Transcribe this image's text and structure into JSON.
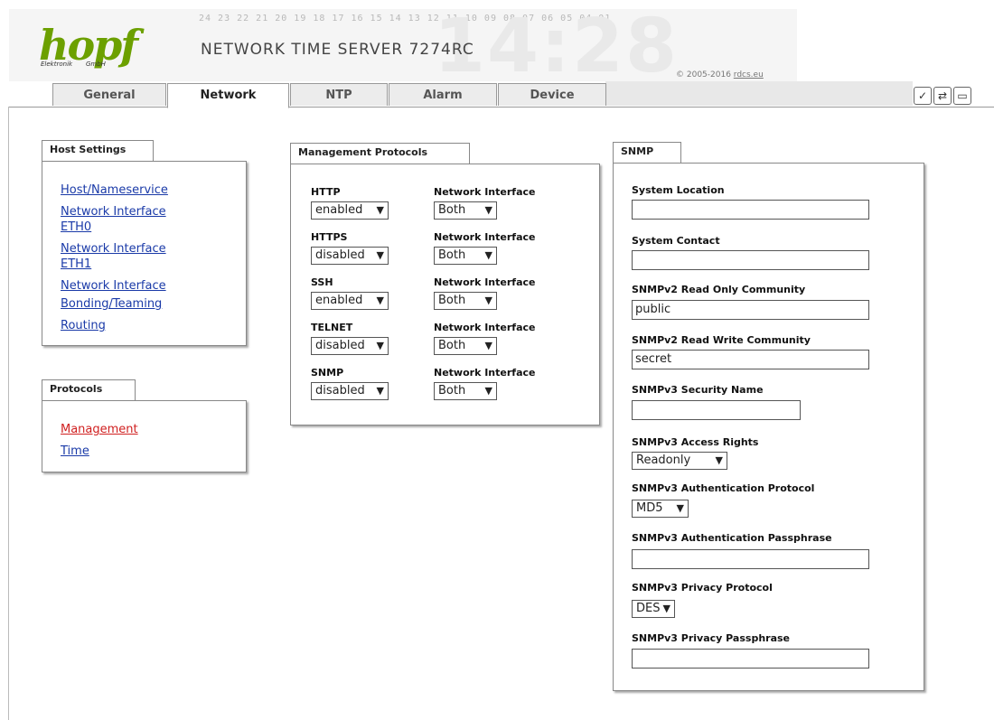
{
  "header": {
    "logo_text": "hopf",
    "logo_sub_left": "Elektronik",
    "logo_sub_right": "GmbH",
    "title": "NETWORK TIME SERVER 7274RC",
    "digits": "24 23 22 21 20 19 18 17 16 15 14 13 12 11 10 09 08 07 06 05 04 01",
    "copyright_prefix": "© 2005-2016 ",
    "copyright_link": "rdcs.eu"
  },
  "tabs": [
    {
      "label": "General"
    },
    {
      "label": "Network"
    },
    {
      "label": "NTP"
    },
    {
      "label": "Alarm"
    },
    {
      "label": "Device"
    }
  ],
  "toolbar_icons": [
    "check-icon",
    "refresh-icon",
    "save-icon"
  ],
  "host_settings": {
    "title": "Host Settings",
    "links": [
      "Host/Nameservice",
      "Network Interface",
      "ETH0",
      "Network Interface",
      "ETH1",
      "Network Interface",
      "Bonding/Teaming",
      "Routing"
    ]
  },
  "protocols": {
    "title": "Protocols",
    "links": [
      "Management",
      "Time"
    ]
  },
  "management": {
    "title": "Management Protocols",
    "iface_label": "Network Interface",
    "rows": [
      {
        "name": "HTTP",
        "value": "enabled",
        "iface": "Both"
      },
      {
        "name": "HTTPS",
        "value": "disabled",
        "iface": "Both"
      },
      {
        "name": "SSH",
        "value": "enabled",
        "iface": "Both"
      },
      {
        "name": "TELNET",
        "value": "disabled",
        "iface": "Both"
      },
      {
        "name": "SNMP",
        "value": "disabled",
        "iface": "Both"
      }
    ]
  },
  "snmp": {
    "title": "SNMP",
    "location_label": "System Location",
    "location_value": "",
    "contact_label": "System Contact",
    "contact_value": "",
    "ro_label": "SNMPv2 Read Only Community",
    "ro_value": "public",
    "rw_label": "SNMPv2 Read Write Community",
    "rw_value": "secret",
    "secname_label": "SNMPv3 Security Name",
    "secname_value": "",
    "access_label": "SNMPv3 Access Rights",
    "access_value": "Readonly",
    "authproto_label": "SNMPv3 Authentication Protocol",
    "authproto_value": "MD5",
    "authpass_label": "SNMPv3 Authentication Passphrase",
    "authpass_value": "",
    "privproto_label": "SNMPv3 Privacy Protocol",
    "privproto_value": "DES",
    "privpass_label": "SNMPv3 Privacy Passphrase",
    "privpass_value": ""
  }
}
